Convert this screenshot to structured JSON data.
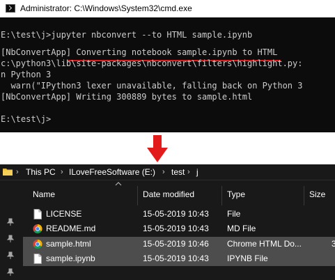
{
  "cmd": {
    "title": "Administrator: C:\\Windows\\System32\\cmd.exe",
    "lines": [
      "",
      "E:\\test\\j>jupyter nbconvert --to HTML sample.ipynb",
      "[NbConvertApp] Converting notebook sample.ipynb to HTML",
      "c:\\python3\\lib\\site-packages\\nbconvert\\filters\\highlight.py:",
      "n Python 3",
      "  warn(\"IPython3 lexer unavailable, falling back on Python 3",
      "[NbConvertApp] Writing 300889 bytes to sample.html",
      "",
      "E:\\test\\j>"
    ],
    "highlight_color": "#e21b1b"
  },
  "arrow": {
    "color": "#e21b1b",
    "icon": "down-arrow-icon"
  },
  "explorer": {
    "breadcrumbs": [
      "This PC",
      "ILoveFreeSoftware (E:)",
      "test",
      "j"
    ],
    "columns": {
      "name": "Name",
      "date": "Date modified",
      "type": "Type",
      "size": "Size"
    },
    "files": [
      {
        "name": "LICENSE",
        "date": "15-05-2019 10:43",
        "type": "File",
        "icon": "blank-file-icon",
        "selected": false
      },
      {
        "name": "README.md",
        "date": "15-05-2019 10:43",
        "type": "MD File",
        "icon": "chrome-icon",
        "selected": false
      },
      {
        "name": "sample.html",
        "date": "15-05-2019 10:46",
        "type": "Chrome HTML Do...",
        "size": "3",
        "icon": "chrome-icon",
        "selected": true
      },
      {
        "name": "sample.ipynb",
        "date": "15-05-2019 10:43",
        "type": "IPYNB File",
        "icon": "blank-file-icon",
        "selected": true
      }
    ],
    "colors": {
      "background": "#191919",
      "selection": "#4d4d4d",
      "folder": "#e8b939"
    }
  }
}
